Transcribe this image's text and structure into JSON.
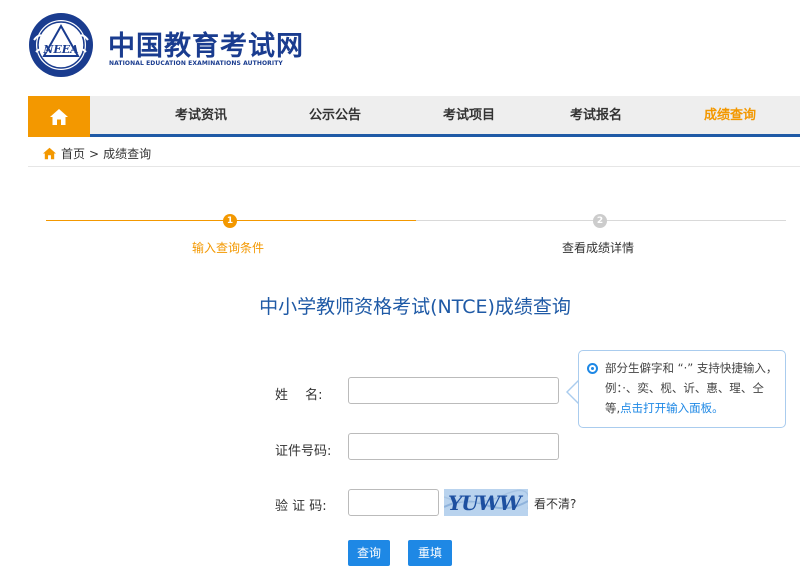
{
  "header": {
    "logo_cn": "中国教育考试网",
    "logo_en": "NATIONAL EDUCATION EXAMINATIONS AUTHORITY",
    "emblem_text": "NEEA"
  },
  "nav": {
    "home_icon": "home-icon",
    "items": [
      {
        "label": "考试资讯"
      },
      {
        "label": "公示公告"
      },
      {
        "label": "考试项目"
      },
      {
        "label": "考试报名"
      },
      {
        "label": "成绩查询"
      }
    ],
    "active_color": "#f39800",
    "bar_color": "#1f5aa6"
  },
  "breadcrumb": {
    "home": "首页",
    "separator": ">",
    "current": "成绩查询"
  },
  "steps": [
    {
      "number": "1",
      "label": "输入查询条件",
      "state": "active"
    },
    {
      "number": "2",
      "label": "查看成绩详情",
      "state": "pending"
    }
  ],
  "page_title": "中小学教师资格考试(NTCE)成绩查询",
  "form": {
    "name_label": "姓　 名:",
    "name_value": "",
    "id_label": "证件号码:",
    "id_value": "",
    "captcha_label": "验 证 码:",
    "captcha_value": "",
    "captcha_text": "YUWW",
    "captcha_refresh": "看不清?",
    "submit_label": "查询",
    "reset_label": "重填"
  },
  "tip": {
    "text": "部分生僻字和 “·” 支持快捷输入，例：·、奕、枧、䜣、惠、瑆、仝等,",
    "link": "点击打开输入面板。"
  }
}
